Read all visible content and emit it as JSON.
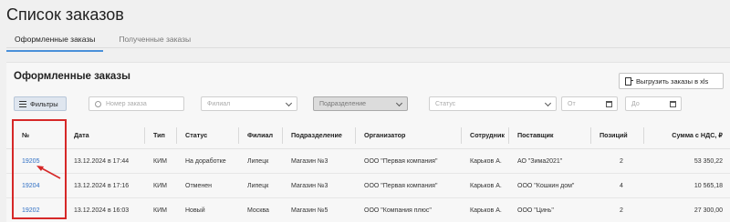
{
  "page": {
    "title": "Список заказов"
  },
  "tabs": [
    {
      "label": "Оформленные заказы",
      "active": true
    },
    {
      "label": "Полученные заказы",
      "active": false
    }
  ],
  "section": {
    "title": "Оформленные заказы",
    "export_label": "Выгрузить заказы в xls"
  },
  "filters": {
    "button_label": "Фильтры",
    "order_number_placeholder": "Номер заказа",
    "branch_placeholder": "Филиал",
    "division_placeholder": "Подразделение",
    "status_placeholder": "Статус",
    "date_from_placeholder": "От",
    "date_to_placeholder": "До"
  },
  "table": {
    "headers": [
      "№",
      "Дата",
      "Тип",
      "Статус",
      "Филиал",
      "Подразделение",
      "Организатор",
      "Сотрудник",
      "Поставщик",
      "Позиций",
      "Сумма с НДС, ₽"
    ],
    "rows": [
      [
        "19205",
        "13.12.2024 в 17:44",
        "КИМ",
        "На доработке",
        "Липецк",
        "Магазин №3",
        "ООО \"Первая компания\"",
        "Карьков А.",
        "АО \"Зима2021\"",
        "2",
        "53 350,22"
      ],
      [
        "19204",
        "13.12.2024 в 17:16",
        "КИМ",
        "Отменен",
        "Липецк",
        "Магазин №3",
        "ООО \"Первая компания\"",
        "Карьков А.",
        "ООО \"Кошкин дом\"",
        "4",
        "10 565,18"
      ],
      [
        "19202",
        "13.12.2024 в 16:03",
        "КИМ",
        "Новый",
        "Москва",
        "Магазин №5",
        "ООО \"Компания плюс\"",
        "Карьков А.",
        "ООО \"Цинь\"",
        "2",
        "27 300,00"
      ]
    ]
  },
  "colors": {
    "accent": "#2f6fc4",
    "highlight": "#d62828",
    "active_tab": "#4a90d9"
  },
  "icons": {
    "export": "document-export-icon",
    "filters": "sliders-icon",
    "search": "search-icon",
    "dropdown": "chevron-down-icon",
    "calendar": "calendar-icon"
  }
}
